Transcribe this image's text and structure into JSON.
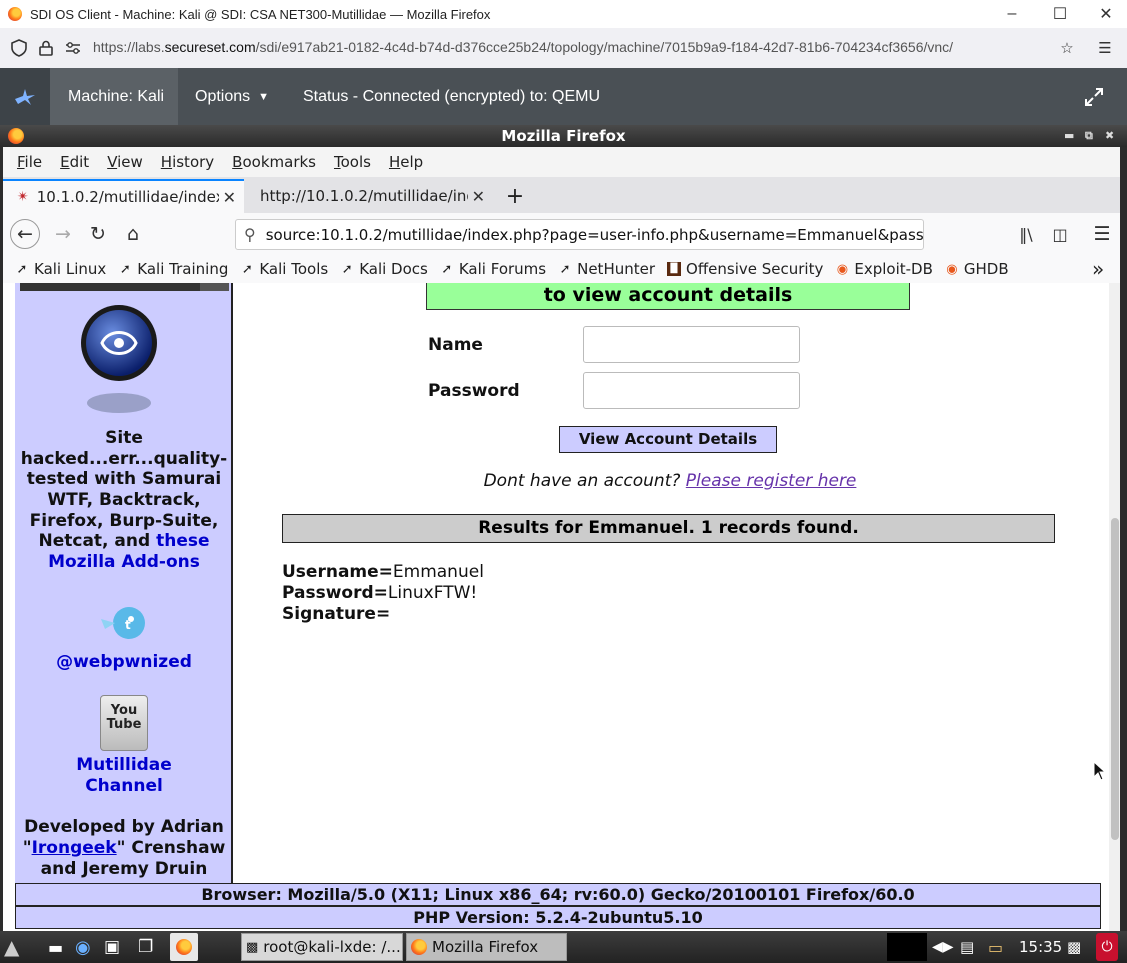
{
  "host": {
    "window_title": "SDI OS Client - Machine: Kali @ SDI: CSA NET300-Mutillidae — Mozilla Firefox",
    "url_prefix": "https://labs.",
    "url_domain": "secureset.com",
    "url_rest": "/sdi/e917ab21-0182-4c4d-b74d-d376cce25b24/topology/machine/7015b9a9-f184-42d7-81b6-704234cf3656/vnc/"
  },
  "sdi_bar": {
    "machine": "Machine: Kali",
    "options": "Options",
    "status": "Status - Connected (encrypted) to: QEMU"
  },
  "firefox": {
    "title": "Mozilla Firefox",
    "menu": [
      "File",
      "Edit",
      "View",
      "History",
      "Bookmarks",
      "Tools",
      "Help"
    ],
    "tabs": [
      {
        "label": "10.1.0.2/mutillidae/index"
      },
      {
        "label": "http://10.1.0.2/mutillidae/ind"
      }
    ],
    "url": "source:10.1.0.2/mutillidae/index.php?page=user-info.php&username=Emmanuel&pass",
    "bookmarks": [
      "Kali Linux",
      "Kali Training",
      "Kali Tools",
      "Kali Docs",
      "Kali Forums",
      "NetHunter",
      "Offensive Security",
      "Exploit-DB",
      "GHDB"
    ]
  },
  "sidebar": {
    "line1": "Site",
    "line2": "hacked...err...quality-",
    "line3": "tested with Samurai",
    "line4": "WTF, Backtrack,",
    "line5": "Firefox, Burp-Suite,",
    "line6a": "Netcat, and ",
    "line6b": "these",
    "line7": "Mozilla Add-ons",
    "twitter": "@webpwnized",
    "youtube_icon_text": "You Tube",
    "channel1": "Mutillidae",
    "channel2": "Channel",
    "dev1": "Developed by Adrian",
    "dev2a": "\"",
    "dev2b": "Irongeek",
    "dev2c": "\" Crenshaw",
    "dev3": "and Jeremy Druin"
  },
  "main": {
    "banner": "to view account details",
    "name_label": "Name",
    "password_label": "Password",
    "view_button": "View Account Details",
    "no_account": "Dont have an account? ",
    "register_link": "Please register here",
    "results": "Results for Emmanuel. 1 records found.",
    "record": {
      "username_label": "Username=",
      "username_value": "Emmanuel",
      "password_label": "Password=",
      "password_value": "LinuxFTW!",
      "signature_label": "Signature="
    }
  },
  "footer": {
    "browser": "Browser: Mozilla/5.0 (X11; Linux x86_64; rv:60.0) Gecko/20100101 Firefox/60.0",
    "php": "PHP Version: 5.2.4-2ubuntu5.10"
  },
  "taskbar": {
    "task1": "root@kali-lxde: /...",
    "task2": "Mozilla Firefox",
    "clock": "15:35"
  }
}
